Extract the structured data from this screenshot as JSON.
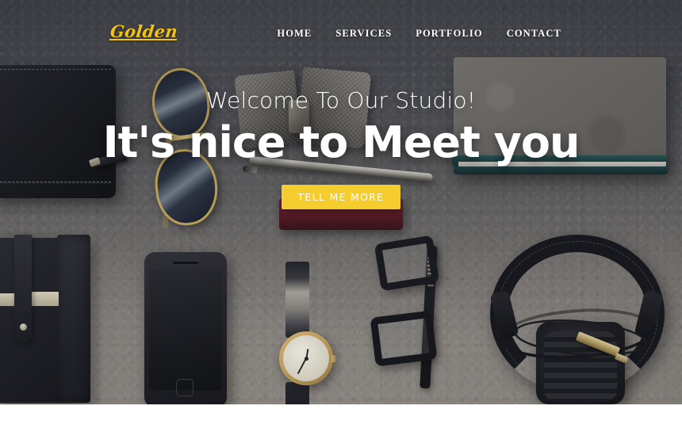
{
  "header": {
    "brand": "Golden",
    "nav": [
      {
        "label": "HOME",
        "name": "nav-home"
      },
      {
        "label": "SERVICES",
        "name": "nav-services"
      },
      {
        "label": "PORTFOLIO",
        "name": "nav-portfolio"
      },
      {
        "label": "CONTACT",
        "name": "nav-contact"
      }
    ]
  },
  "hero": {
    "kicker": "Welcome To Our Studio!",
    "title": "It's nice to Meet you",
    "cta_label": "TELL ME MORE",
    "scene_description": "Flat-lay photograph of desk accessories on grey concrete",
    "objects": [
      "leather-zip-wallet",
      "leather-card-holder",
      "gold-aviator-sunglasses",
      "tweed-bow-tie",
      "silver-ballpoint-pen",
      "red-notebook",
      "stacked-notebooks",
      "black-smartphone",
      "gold-wristwatch",
      "black-eyeglasses",
      "black-headphones"
    ]
  },
  "colors": {
    "brand_yellow": "#f3c30f",
    "cta_yellow": "#f5cd2e",
    "cta_text": "#ffffff",
    "hero_text": "#ffffff",
    "page_background": "#ffffff",
    "backdrop_top": "#4f5157",
    "backdrop_bottom": "#96918b"
  }
}
